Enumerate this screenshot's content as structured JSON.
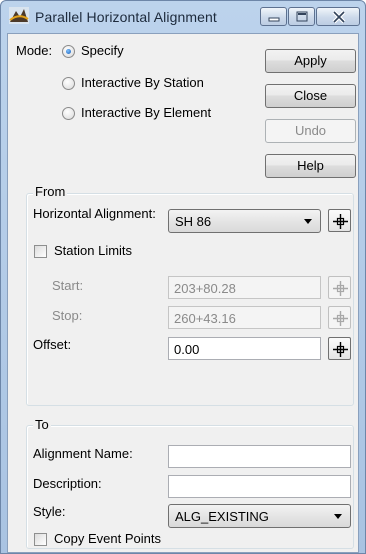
{
  "window": {
    "title": "Parallel Horizontal Alignment",
    "colors": {
      "title_bg": "#bcd3ec",
      "client_bg": "#f0f0f0",
      "radio_dot": "#1559b5"
    }
  },
  "mode": {
    "label": "Mode:",
    "options": [
      {
        "label": "Specify",
        "selected": true
      },
      {
        "label": "Interactive By Station",
        "selected": false
      },
      {
        "label": "Interactive By Element",
        "selected": false
      }
    ]
  },
  "buttons": {
    "apply": "Apply",
    "close": "Close",
    "undo": "Undo",
    "help": "Help"
  },
  "from": {
    "title": "From",
    "horizontal_alignment_label": "Horizontal Alignment:",
    "horizontal_alignment_value": "SH 86",
    "station_limits_label": "Station Limits",
    "station_limits_checked": false,
    "start_label": "Start:",
    "start_value": "203+80.28",
    "stop_label": "Stop:",
    "stop_value": "260+43.16",
    "offset_label": "Offset:",
    "offset_value": "0.00"
  },
  "to": {
    "title": "To",
    "alignment_name_label": "Alignment Name:",
    "alignment_name_value": "",
    "description_label": "Description:",
    "description_value": "",
    "style_label": "Style:",
    "style_value": "ALG_EXISTING",
    "copy_event_points_label": "Copy Event Points",
    "copy_event_points_checked": false
  },
  "icons": {
    "app": "alignment-app-icon",
    "locate": "crosshair-locate-icon",
    "minimize": "minimize-icon",
    "maximize": "maximize-icon",
    "close": "close-x-icon"
  }
}
